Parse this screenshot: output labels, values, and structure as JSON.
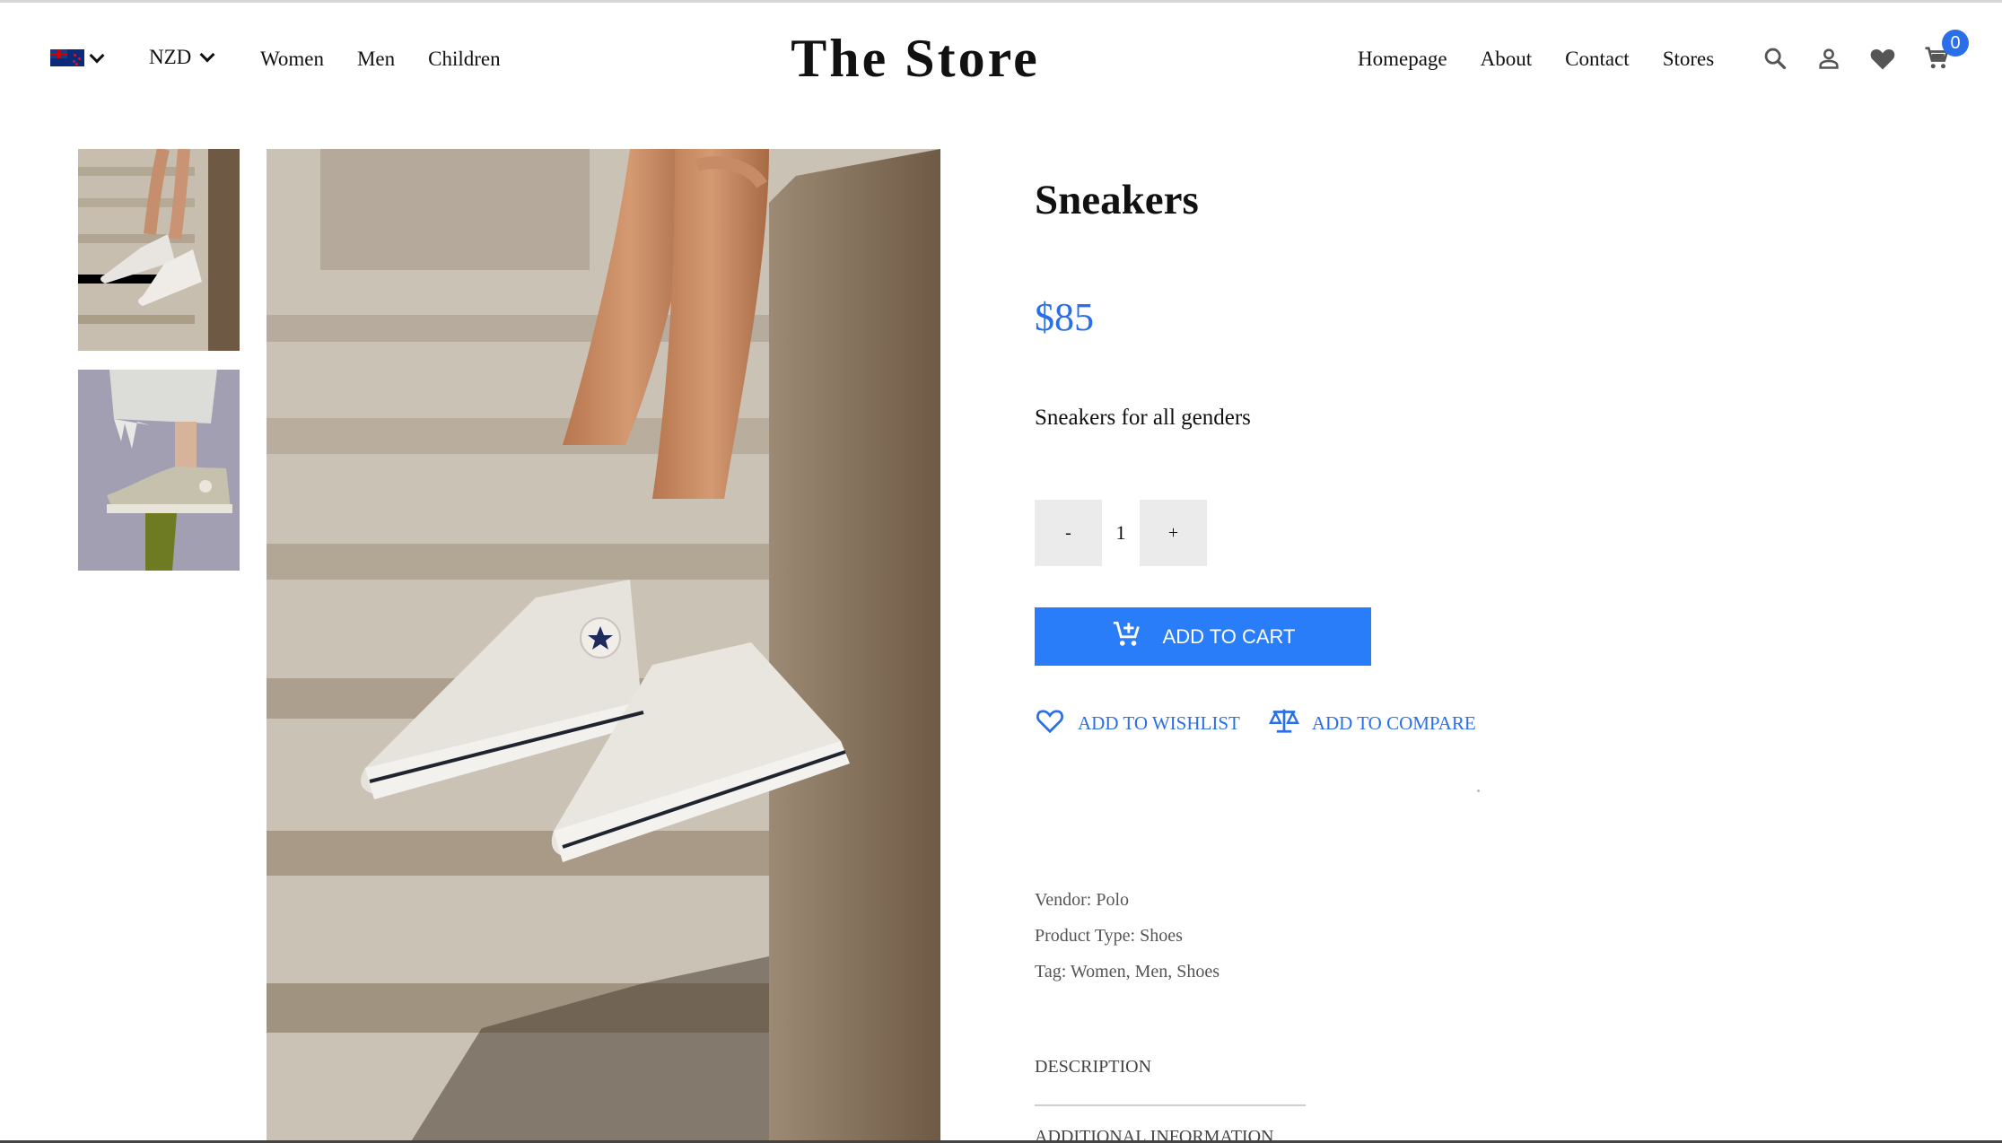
{
  "header": {
    "region_icon": "nz-flag-icon",
    "currency": "NZD",
    "nav_left": [
      "Women",
      "Men",
      "Children"
    ],
    "logo": "The Store",
    "nav_right": [
      "Homepage",
      "About",
      "Contact",
      "Stores"
    ],
    "icons": [
      "search-icon",
      "user-icon",
      "heart-icon",
      "cart-icon"
    ],
    "cart_count": "0"
  },
  "product": {
    "title": "Sneakers",
    "price": "$85",
    "description": "Sneakers for all genders",
    "quantity": "1",
    "qty_minus": "-",
    "qty_plus": "+",
    "add_to_cart": "ADD TO CART",
    "add_to_wishlist": "ADD TO WISHLIST",
    "add_to_compare": "ADD TO COMPARE",
    "vendor": "Vendor: Polo",
    "product_type": "Product Type: Shoes",
    "tags": "Tag: Women, Men, Shoes"
  },
  "tabs": [
    "DESCRIPTION",
    "ADDITIONAL INFORMATION"
  ],
  "colors": {
    "accent": "#2a6fe8",
    "button": "#2a7df8",
    "qty_bg": "#ebebeb"
  }
}
